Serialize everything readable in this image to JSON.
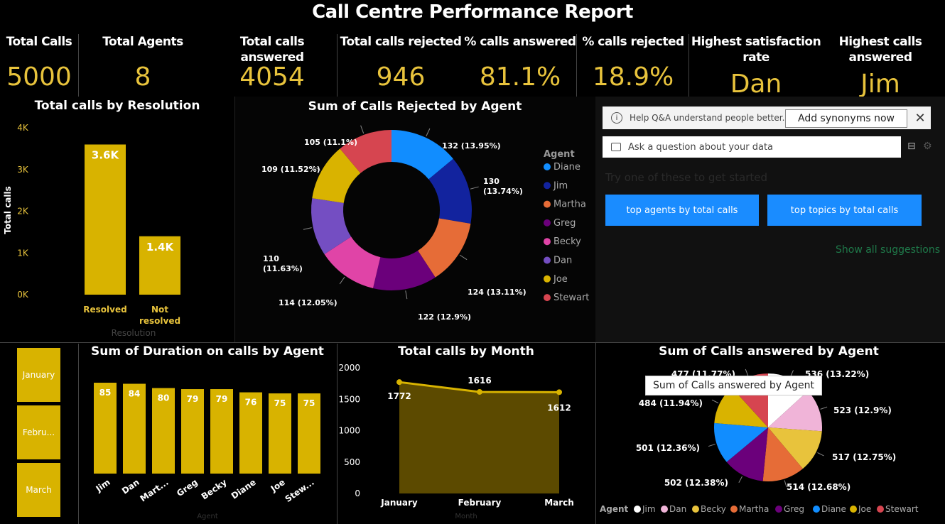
{
  "title": "Call Centre Performance Report",
  "kpis": [
    {
      "label": "Total Calls",
      "value": "5000"
    },
    {
      "label": "Total Agents",
      "value": "8"
    },
    {
      "label": "Total calls answered",
      "value": "4054"
    },
    {
      "label": "Total calls rejected",
      "value": "946"
    },
    {
      "label": "% calls answered",
      "value": "81.1%"
    },
    {
      "label": "% calls rejected",
      "value": "18.9%"
    },
    {
      "label": "Highest satisfaction rate",
      "value": "Dan"
    },
    {
      "label": "Highest calls answered",
      "value": "Jim"
    }
  ],
  "qa": {
    "banner_text": "Help Q&A understand people better...",
    "add_synonyms_label": "Add synonyms now",
    "ask_placeholder": "Ask a question about your data",
    "hint": "Try one of these to get started",
    "suggestions": [
      "top agents by total calls",
      "top topics by total calls"
    ],
    "show_all": "Show all suggestions"
  },
  "month_slicer": [
    "January",
    "Febru...",
    "March"
  ],
  "tooltip": "Sum of Calls answered by Agent",
  "colors": {
    "accent": "#e8c33c",
    "bar": "#d8b300",
    "area": "#5c4a00",
    "button_blue": "#1a8cff"
  },
  "chart_data": [
    {
      "type": "bar",
      "title": "Total calls by Resolution",
      "categories": [
        "Resolved",
        "Not resolved"
      ],
      "values": [
        3600,
        1400
      ],
      "data_labels": [
        "3.6K",
        "1.4K"
      ],
      "xlabel": "Resolution",
      "ylabel": "Total calls",
      "yticks": [
        "0K",
        "1K",
        "2K",
        "3K",
        "4K"
      ],
      "ylim": [
        0,
        4000
      ]
    },
    {
      "type": "pie",
      "donut": true,
      "title": "Sum of Calls Rejected by Agent",
      "legend_title": "Agent",
      "legend_position": "right",
      "slices": [
        {
          "name": "Diane",
          "value": 132,
          "label": "132 (13.95%)",
          "color": "#118dff"
        },
        {
          "name": "Jim",
          "value": 130,
          "label": "130 (13.74%)",
          "color": "#12239e"
        },
        {
          "name": "Martha",
          "value": 124,
          "label": "124 (13.11%)",
          "color": "#e66c37"
        },
        {
          "name": "Greg",
          "value": 122,
          "label": "122 (12.9%)",
          "color": "#6b007b"
        },
        {
          "name": "Becky",
          "value": 114,
          "label": "114 (12.05%)",
          "color": "#e044a7"
        },
        {
          "name": "Dan",
          "value": 110,
          "label": "110 (11.63%)",
          "color": "#744ec2"
        },
        {
          "name": "Joe",
          "value": 109,
          "label": "109 (11.52%)",
          "color": "#d9b300"
        },
        {
          "name": "Stewart",
          "value": 105,
          "label": "105 (11.1%)",
          "color": "#d64550"
        }
      ]
    },
    {
      "type": "bar",
      "title": "Sum of Duration on calls by Agent",
      "categories": [
        "Jim",
        "Dan",
        "Mart...",
        "Greg",
        "Becky",
        "Diane",
        "Joe",
        "Stew..."
      ],
      "values": [
        85,
        84,
        80,
        79,
        79,
        76,
        75,
        75
      ],
      "xlabel": "Agent"
    },
    {
      "type": "area",
      "title": "Total calls by Month",
      "categories": [
        "January",
        "February",
        "March"
      ],
      "values": [
        1772,
        1616,
        1612
      ],
      "yticks": [
        "0",
        "500",
        "1000",
        "1500",
        "2000"
      ],
      "ylim": [
        0,
        2000
      ],
      "xlabel": "Month"
    },
    {
      "type": "pie",
      "title": "Sum of Calls answered by Agent",
      "legend_title": "Agent",
      "legend_position": "bottom",
      "slices": [
        {
          "name": "Jim",
          "value": 536,
          "label": "536 (13.22%)",
          "color": "#ffffff"
        },
        {
          "name": "Dan",
          "value": 523,
          "label": "523 (12.9%)",
          "color": "#f0b4d8"
        },
        {
          "name": "Becky",
          "value": 517,
          "label": "517 (12.75%)",
          "color": "#e8c33c"
        },
        {
          "name": "Martha",
          "value": 514,
          "label": "514 (12.68%)",
          "color": "#e66c37"
        },
        {
          "name": "Greg",
          "value": 502,
          "label": "502 (12.38%)",
          "color": "#6b007b"
        },
        {
          "name": "Diane",
          "value": 501,
          "label": "501 (12.36%)",
          "color": "#118dff"
        },
        {
          "name": "Joe",
          "value": 484,
          "label": "484 (11.94%)",
          "color": "#d9b300"
        },
        {
          "name": "Stewart",
          "value": 477,
          "label": "477 (11.77%)",
          "color": "#d64550"
        }
      ]
    }
  ]
}
